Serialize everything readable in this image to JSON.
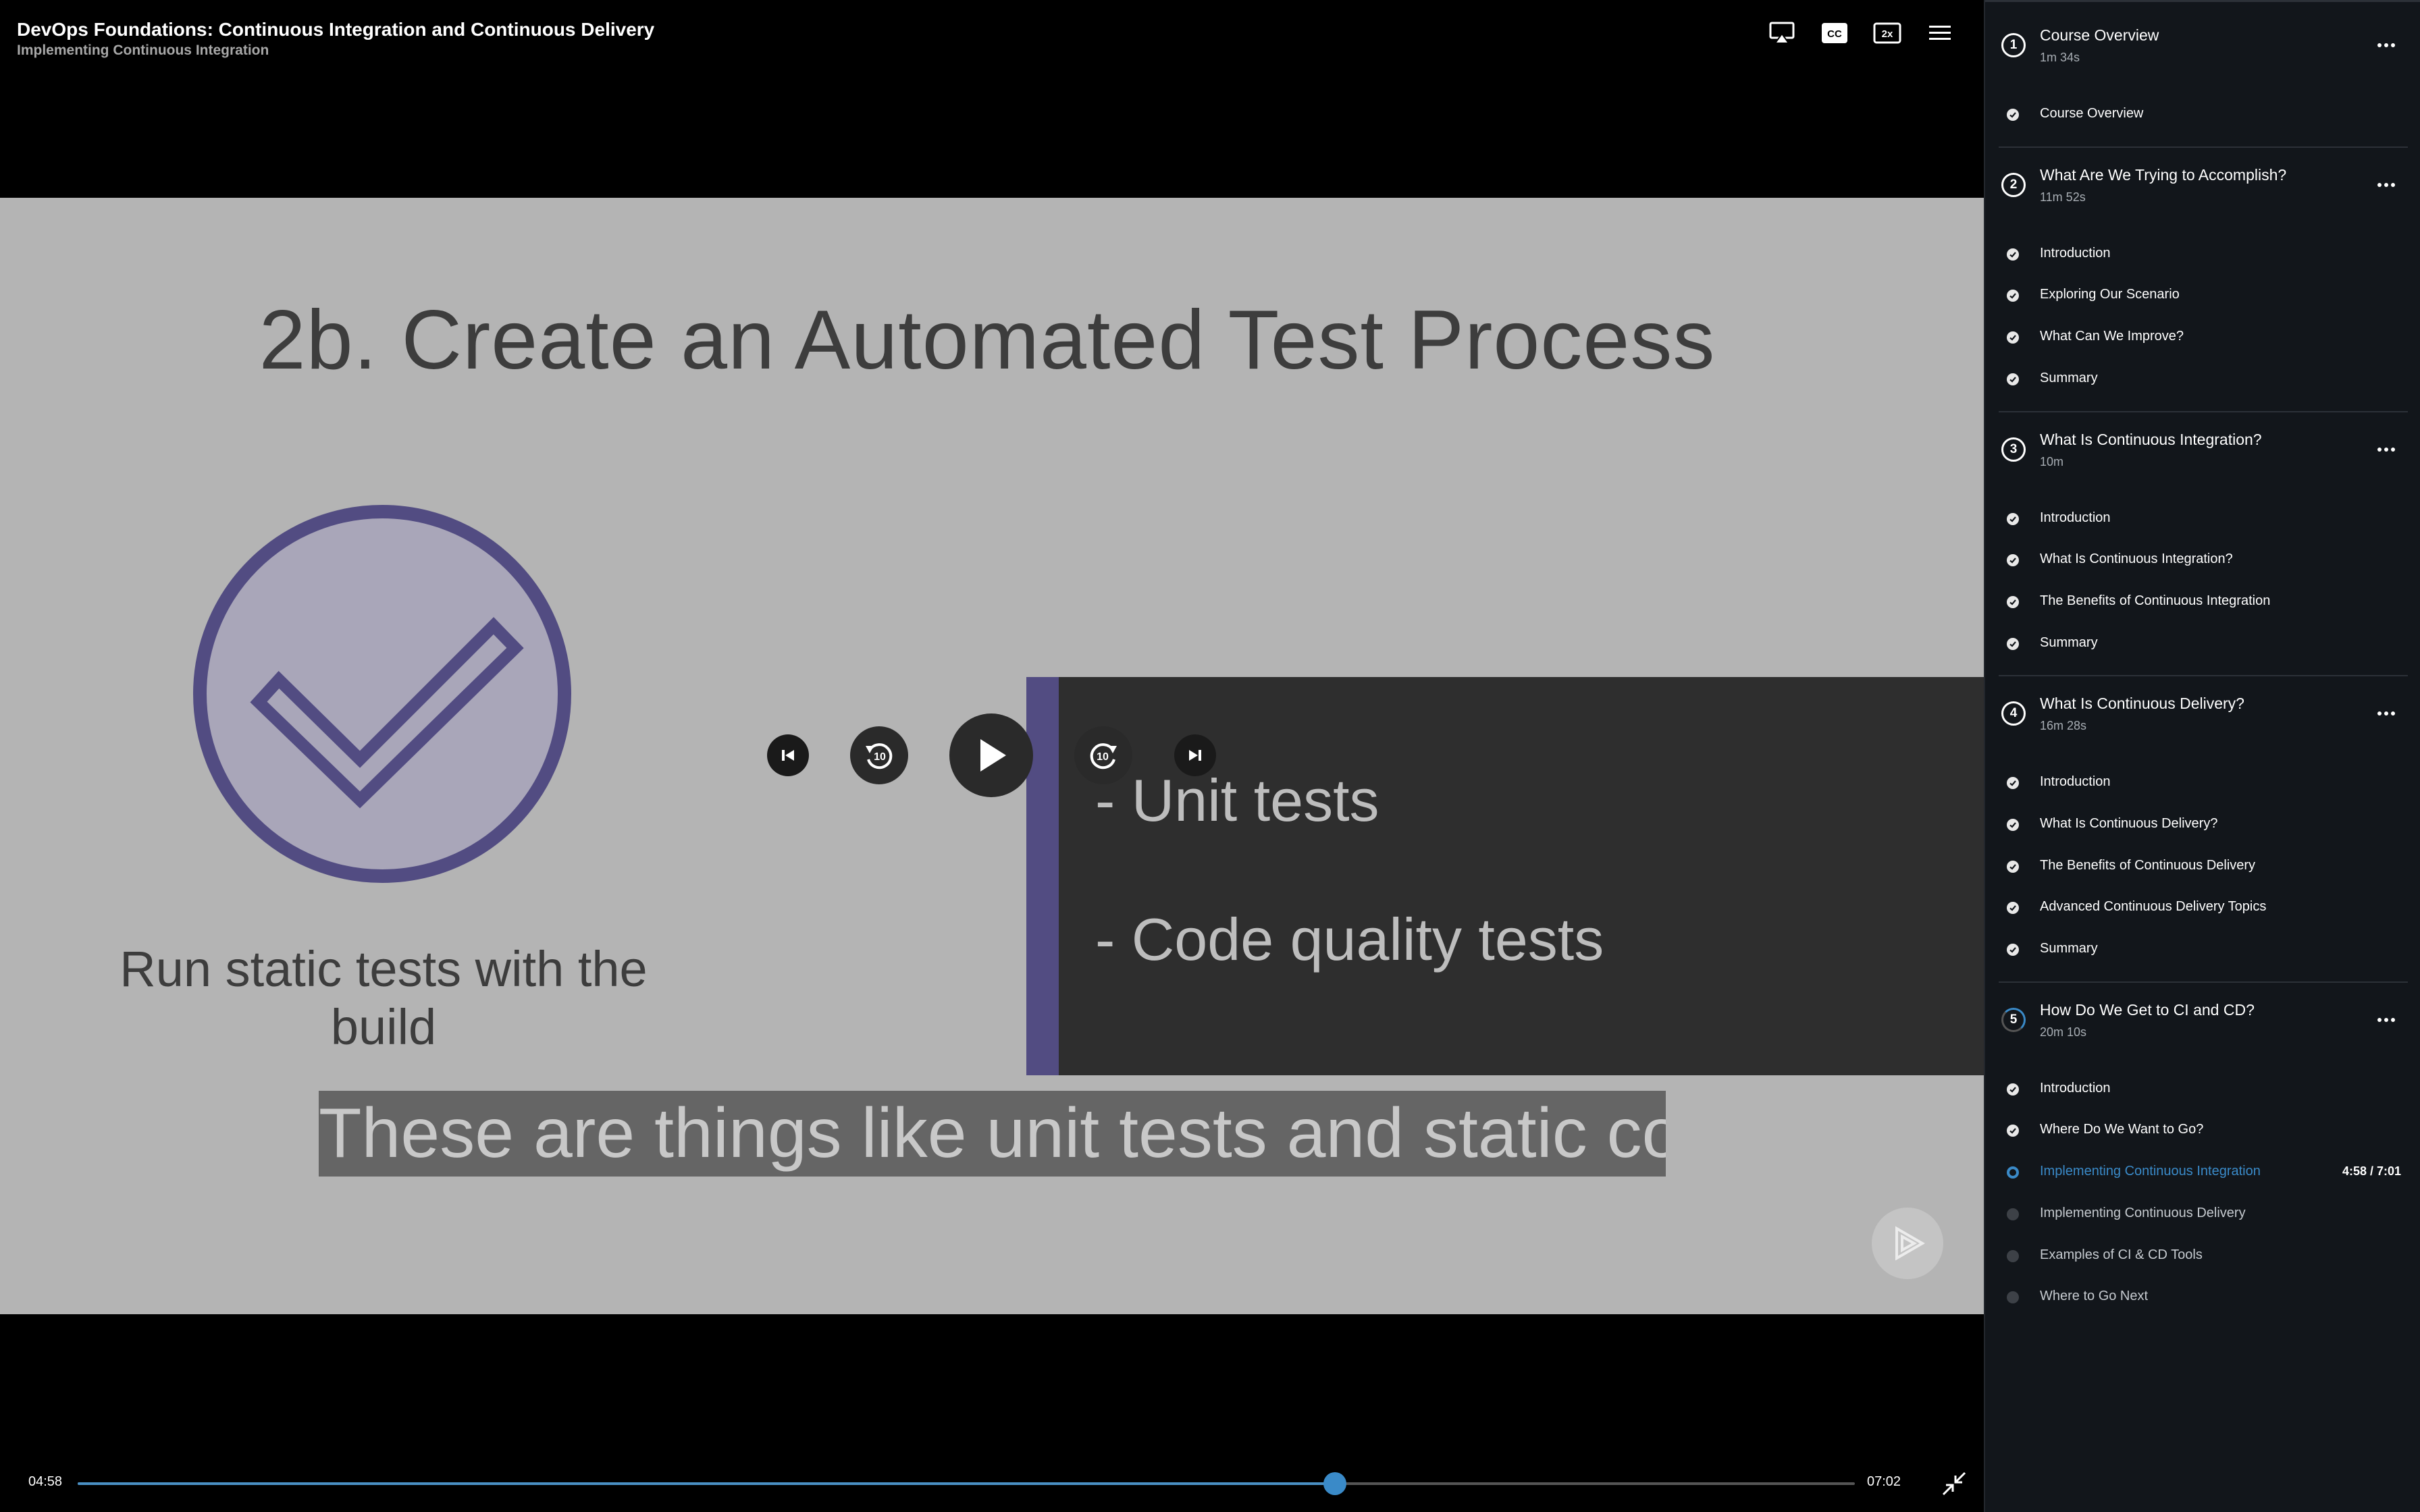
{
  "header": {
    "course_title": "DevOps Foundations: Continuous Integration and Continuous Delivery",
    "module_title": "Implementing Continuous Integration",
    "icons": [
      "airplay-icon",
      "closed-captions-icon",
      "playback-speed-icon",
      "menu-icon"
    ],
    "cc_label": "CC",
    "speed_label": "2x"
  },
  "slide": {
    "title": "2b. Create an Automated Test Process",
    "left_caption": "Run static tests with the build",
    "bullets": [
      "- Unit tests",
      "- Code quality tests"
    ],
    "accent_color": "#524c82"
  },
  "caption": "These are things like unit tests and static code",
  "controls": {
    "skip_back_seconds": "10",
    "skip_forward_seconds": "10"
  },
  "progress": {
    "current": "04:58",
    "total": "07:02",
    "fraction": 0.7073
  },
  "sidebar": {
    "modules": [
      {
        "number": "1",
        "title": "Course Overview",
        "duration": "1m 34s",
        "status": "complete",
        "clips": [
          {
            "label": "Course Overview",
            "status": "complete"
          }
        ]
      },
      {
        "number": "2",
        "title": "What Are We Trying to Accomplish?",
        "duration": "11m 52s",
        "status": "complete",
        "clips": [
          {
            "label": "Introduction",
            "status": "complete"
          },
          {
            "label": "Exploring Our Scenario",
            "status": "complete"
          },
          {
            "label": "What Can We Improve?",
            "status": "complete"
          },
          {
            "label": "Summary",
            "status": "complete"
          }
        ]
      },
      {
        "number": "3",
        "title": "What Is Continuous Integration?",
        "duration": "10m",
        "status": "complete",
        "clips": [
          {
            "label": "Introduction",
            "status": "complete"
          },
          {
            "label": "What Is Continuous Integration?",
            "status": "complete"
          },
          {
            "label": "The Benefits of Continuous Integration",
            "status": "complete"
          },
          {
            "label": "Summary",
            "status": "complete"
          }
        ]
      },
      {
        "number": "4",
        "title": "What Is Continuous Delivery?",
        "duration": "16m 28s",
        "status": "complete",
        "clips": [
          {
            "label": "Introduction",
            "status": "complete"
          },
          {
            "label": "What Is Continuous Delivery?",
            "status": "complete"
          },
          {
            "label": "The Benefits of Continuous Delivery",
            "status": "complete"
          },
          {
            "label": "Advanced Continuous Delivery Topics",
            "status": "complete"
          },
          {
            "label": "Summary",
            "status": "complete"
          }
        ]
      },
      {
        "number": "5",
        "title": "How Do We Get to CI and CD?",
        "duration": "20m 10s",
        "status": "in-progress",
        "clips": [
          {
            "label": "Introduction",
            "status": "complete"
          },
          {
            "label": "Where Do We Want to Go?",
            "status": "complete"
          },
          {
            "label": "Implementing Continuous Integration",
            "status": "current",
            "progress": "4:58 / 7:01"
          },
          {
            "label": "Implementing Continuous Delivery",
            "status": "pending"
          },
          {
            "label": "Examples of CI & CD Tools",
            "status": "pending"
          },
          {
            "label": "Where to Go Next",
            "status": "pending"
          }
        ]
      }
    ]
  },
  "colors": {
    "accent_blue": "#3a8ac8",
    "sidebar_bg": "#12161b",
    "slide_bg": "#b4b4b4"
  }
}
